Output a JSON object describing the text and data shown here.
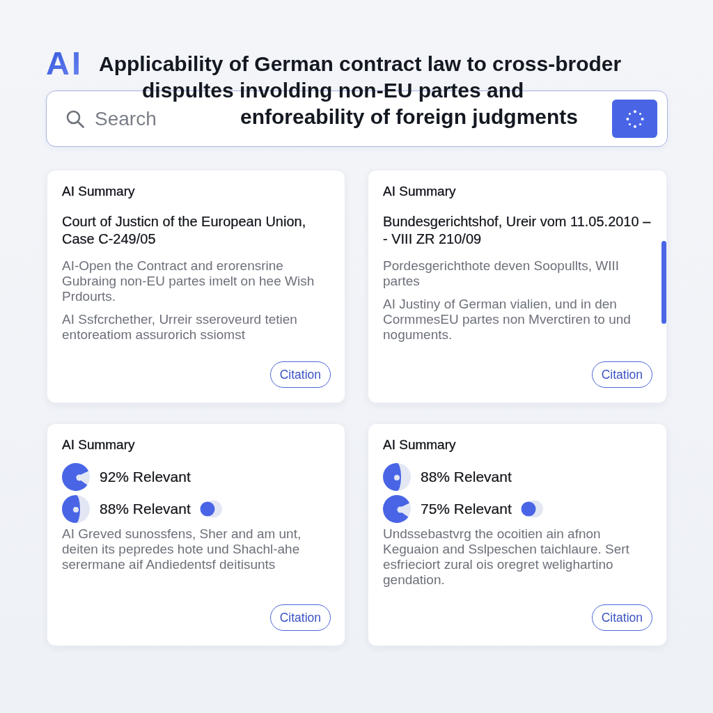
{
  "header": {
    "logo": "AI",
    "title": [
      "Applicability of German contract law to cross-broder",
      "dispultes involding non-EU partes and",
      "enforeability of foreign judgments"
    ]
  },
  "search": {
    "placeholder": "Search"
  },
  "cards": [
    {
      "label": "AI Summary",
      "heading": "Court of Justicn of the European Union,\nCase C-249/05",
      "paragraphs": [
        "AI-Open the Contract and erorensrine\nGubraing non-EU partes imelt on hee Wish\nPrdourts.",
        "AI Ssfcrchether, Urreir sseroveurd tetien\nentoreatiom assurorich ssiomst"
      ],
      "citation": "Citation",
      "scrollbar": false
    },
    {
      "label": "AI Summary",
      "heading": "Bundesgerichtshof, Ureir vom 11.05.2010 –\n- VIII ZR 210/09",
      "paragraphs": [
        "Pordesgerichthote deven Soopullts, WIII\npartes",
        "AI Justiny of German vialien, und in den\nCormmesEU partes non Mverctiren to und\nnoguments."
      ],
      "citation": "Citation",
      "scrollbar": true
    },
    {
      "label": "AI Summary",
      "relevance": [
        {
          "kind": "pie",
          "label": "92% Relevant",
          "marker": false
        },
        {
          "kind": "crescent",
          "label": "88% Relevant",
          "marker": true
        }
      ],
      "paragraphs": [
        "AI Greved sunossfens, Sher and am unt,\ndeiten its pepredes hote und Shachl-ahe\nserermane aif Andiedentsf deitisunts"
      ],
      "citation": "Citation",
      "scrollbar": false
    },
    {
      "label": "AI Summary",
      "relevance": [
        {
          "kind": "crescent",
          "label": "88% Relevant",
          "marker": false
        },
        {
          "kind": "pie",
          "label": "75% Relevant",
          "marker": true
        }
      ],
      "paragraphs": [
        "Undssebastvrg the ocoitien ain afnon\nKeguaion and Sslpeschen taichlaure. Sert\nesfrieciort zural ois oregret welighartino\ngendation."
      ],
      "citation": "Citation",
      "scrollbar": false
    }
  ]
}
